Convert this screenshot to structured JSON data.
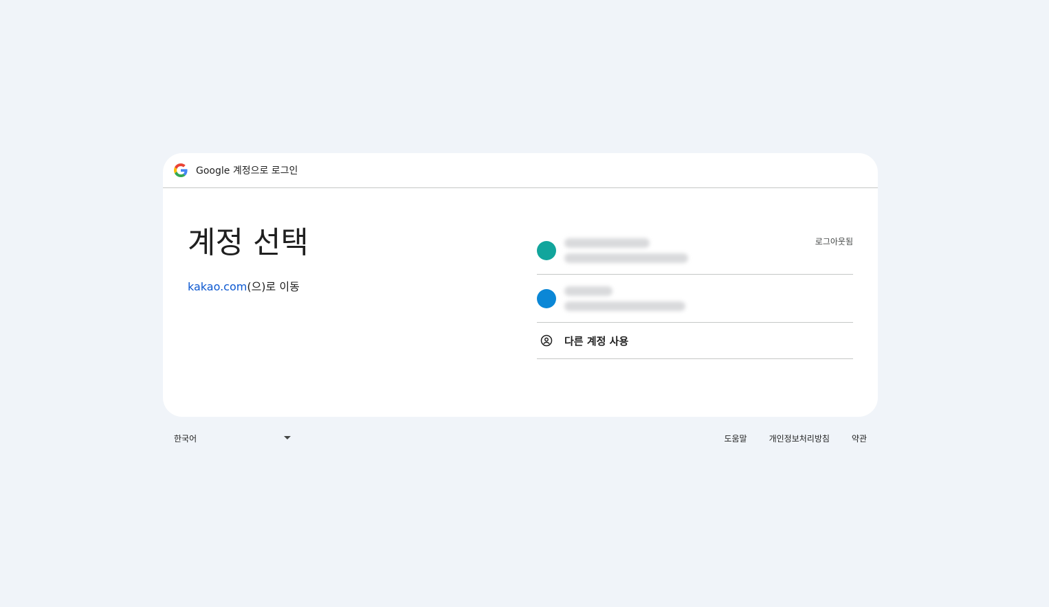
{
  "header": {
    "title": "Google 계정으로 로그인",
    "logo_icon": "google-g-icon"
  },
  "main": {
    "heading": "계정 선택",
    "subtitle_link": "kakao.com",
    "subtitle_suffix": "(으)로 이동"
  },
  "accounts": [
    {
      "avatar_color": "#12a59c",
      "status": "로그아웃됨"
    },
    {
      "avatar_color": "#0b87d6",
      "status": ""
    }
  ],
  "use_other": {
    "label": "다른 계정 사용",
    "icon": "account-circle-icon"
  },
  "footer": {
    "language": "한국어",
    "links": [
      "도움말",
      "개인정보처리방침",
      "약관"
    ]
  },
  "colors": {
    "background": "#f0f4f9",
    "card": "#ffffff",
    "link": "#0b57d0",
    "divider": "#c4c7c5"
  }
}
